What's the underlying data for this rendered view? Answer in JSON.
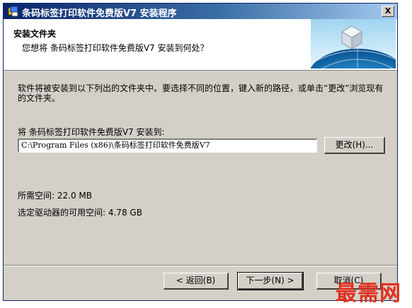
{
  "window": {
    "title": "条码标签打印软件免费版V7  安装程序",
    "close_label": "X"
  },
  "header": {
    "title": "安装文件夹",
    "subtitle": "您想将 条码标签打印软件免费版V7 安装到何处？"
  },
  "content": {
    "intro": "软件将被安装到以下列出的文件夹中。要选择不同的位置，键入新的路径，或单击“更改”浏览现有的文件夹。",
    "install_to_label": "将 条码标签打印软件免费版V7 安装到:",
    "path_value": "C:\\Program Files (x86)\\条码标签打印软件免费版V7",
    "change_button": "更改(H)...",
    "space_required": "所需空间: 22.0 MB",
    "space_available": "选定驱动器的可用空间: 4.78 GB"
  },
  "footer": {
    "back_button": "< 返回(B)",
    "next_button": "下一步(N) >",
    "cancel_button": "取消(C)"
  },
  "watermark": "最需网",
  "colors": {
    "titlebar_start": "#0a246a",
    "titlebar_end": "#a6caf0",
    "face": "#d4d0c8",
    "watermark": "#e0301e"
  }
}
